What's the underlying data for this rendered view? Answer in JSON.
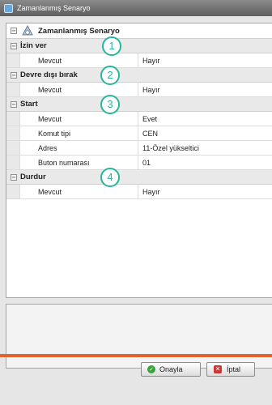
{
  "window": {
    "title": "Zamanlanmış Senaryo"
  },
  "grid": {
    "root_label": "Zamanlanmış Senaryo",
    "sections": [
      {
        "label": "İzin ver",
        "callout": "1",
        "rows": [
          {
            "name": "Mevcut",
            "value": "Hayır"
          }
        ]
      },
      {
        "label": "Devre dışı bırak",
        "callout": "2",
        "rows": [
          {
            "name": "Mevcut",
            "value": "Hayır"
          }
        ]
      },
      {
        "label": "Start",
        "callout": "3",
        "rows": [
          {
            "name": "Mevcut",
            "value": "Evet"
          },
          {
            "name": "Komut tipi",
            "value": "CEN"
          },
          {
            "name": "Adres",
            "value": "11-Özel yükseltici"
          },
          {
            "name": "Buton numarası",
            "value": "01"
          }
        ]
      },
      {
        "label": "Durdur",
        "callout": "4",
        "rows": [
          {
            "name": "Mevcut",
            "value": "Hayır"
          }
        ]
      }
    ]
  },
  "footer": {
    "ok_label": "Onayla",
    "cancel_label": "İptal"
  },
  "colors": {
    "accent": "#e2632e",
    "callout": "#28b59c",
    "title_bar": "#6f6f6f"
  },
  "icons": {
    "root": "scenario-timer-icon",
    "ok": "check-circle-icon",
    "cancel": "close-box-icon"
  }
}
